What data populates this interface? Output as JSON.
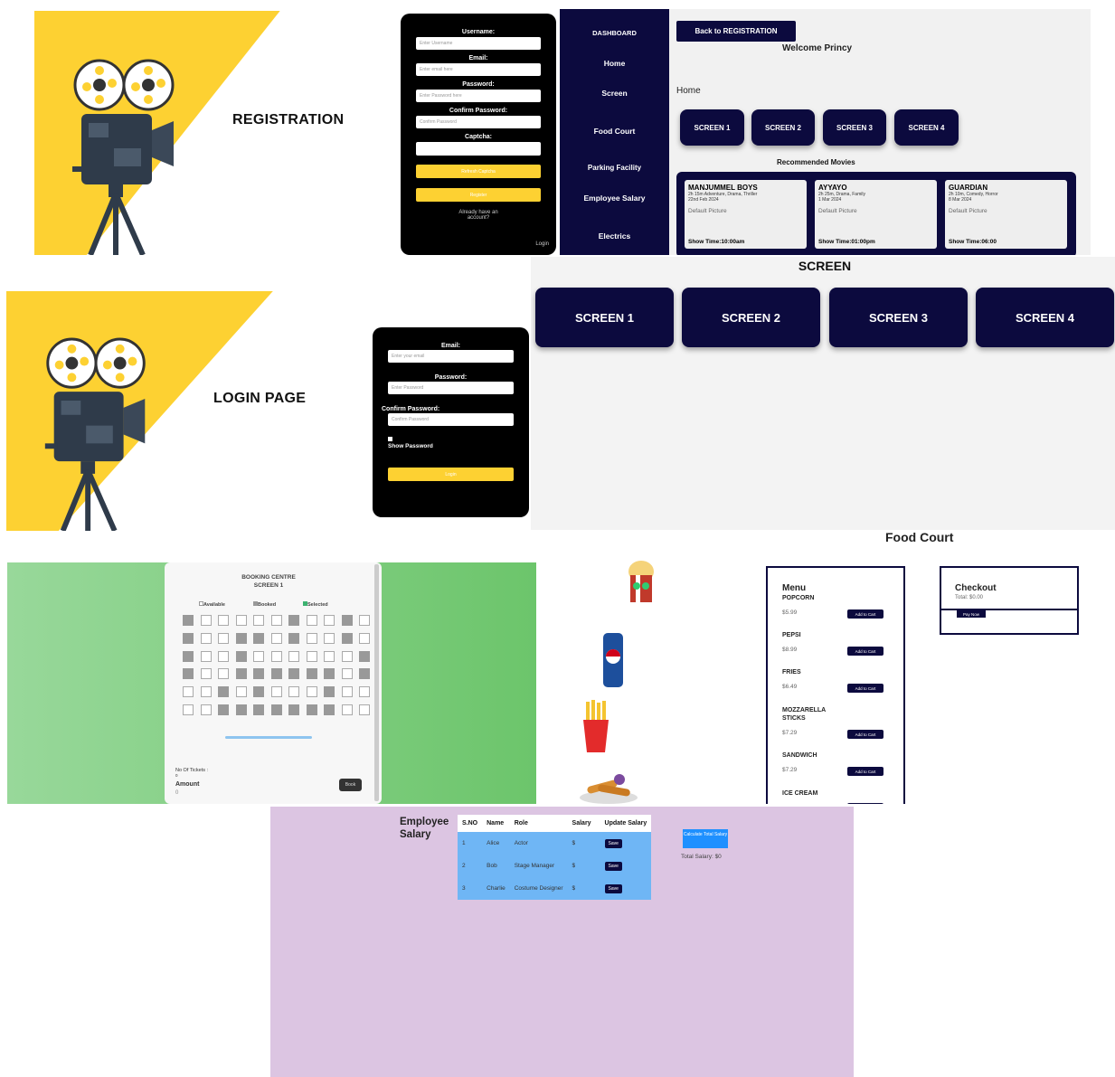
{
  "registration": {
    "title": "REGISTRATION",
    "username_label": "Username:",
    "username_placeholder": "Enter Username",
    "email_label": "Email:",
    "email_placeholder": "Enter email here",
    "password_label": "Password:",
    "password_placeholder": "Enter Password here",
    "confirm_label": "Confirm Password:",
    "confirm_placeholder": "Confirm Password",
    "captcha_label": "Captcha:",
    "captcha_button": "Refresh Captcha",
    "register_button": "Register",
    "already": "Already have an account?",
    "login_link": "Login"
  },
  "dashboard": {
    "sidebar": [
      "DASHBOARD",
      "Home",
      "Screen",
      "Food Court",
      "Parking Facility",
      "Employee Salary",
      "Electrics"
    ],
    "back_button": "Back to REGISTRATION",
    "welcome": "Welcome Princy",
    "home_heading": "Home",
    "screens": [
      "SCREEN 1",
      "SCREEN 2",
      "SCREEN 3",
      "SCREEN 4"
    ],
    "recommended": "Recommended Movies",
    "movies": [
      {
        "title": "MANJUMMEL BOYS",
        "meta1": "2h 15m Adventure, Drama, Thriller",
        "meta2": "22nd Feb 2024",
        "img_alt": "Default Picture",
        "show": "Show Time:10:00am"
      },
      {
        "title": "AYYAYO",
        "meta1": "2h 25m, Drama, Family",
        "meta2": "1 Mar 2024",
        "img_alt": "Default Picture",
        "show": "Show Time:01:00pm"
      },
      {
        "title": "GUARDIAN",
        "meta1": "2h 10m, Comedy, Horror",
        "meta2": "8 Mar 2024",
        "img_alt": "Default Picture",
        "show": "Show Time:06:00"
      }
    ]
  },
  "login": {
    "title": "LOGIN PAGE",
    "email_label": "Email:",
    "email_placeholder": "Enter your email",
    "password_label": "Password:",
    "password_placeholder": "Enter Password",
    "confirm_label": "Confirm Password:",
    "confirm_placeholder": "Confirm Password",
    "show_password": "Show Password",
    "login_button": "Login"
  },
  "screen_page": {
    "title": "SCREEN",
    "screens": [
      "SCREEN 1",
      "SCREEN 2",
      "SCREEN 3",
      "SCREEN 4"
    ]
  },
  "booking": {
    "title": "BOOKING CENTRE",
    "subtitle": "SCREEN 1",
    "legend": [
      "Available",
      "Booked",
      "Selected"
    ],
    "tickets_label": "No Of Tickets :",
    "tickets_value": "0",
    "amount_label": "Amount",
    "amount_value": "0",
    "book_button": "Book"
  },
  "food_court": {
    "title": "Food Court",
    "menu_title": "Menu",
    "items": [
      {
        "name": "POPCORN",
        "price": "$5.99"
      },
      {
        "name": "PEPSI",
        "price": "$8.99"
      },
      {
        "name": "FRIES",
        "price": "$6.49"
      },
      {
        "name": "MOZZARELLA STICKS",
        "price": "$7.29"
      },
      {
        "name": "SANDWICH",
        "price": "$7.29"
      },
      {
        "name": "ICE CREAM",
        "price": ""
      }
    ],
    "add_button": "Add to Cart",
    "checkout_title": "Checkout",
    "total": "Total: $0.00",
    "pay_button": "Pay Now"
  },
  "employee": {
    "title": "Employee Salary",
    "headers": [
      "S.NO",
      "Name",
      "Role",
      "Salary",
      "Update Salary"
    ],
    "rows": [
      {
        "sno": "1",
        "name": "Alice",
        "role": "Actor",
        "salary": "$"
      },
      {
        "sno": "2",
        "name": "Bob",
        "role": "Stage Manager",
        "salary": "$"
      },
      {
        "sno": "3",
        "name": "Charlie",
        "role": "Costume Designer",
        "salary": "$"
      }
    ],
    "save_button": "Save",
    "calc_button": "Calculate Total Salary",
    "total": "Total Salary: $0"
  },
  "colors": {
    "navy": "#0c0a3e",
    "yellow": "#fdd132",
    "green": "#6cc56b",
    "purple": "#dcc5e2",
    "blue": "#6fb6f5"
  }
}
